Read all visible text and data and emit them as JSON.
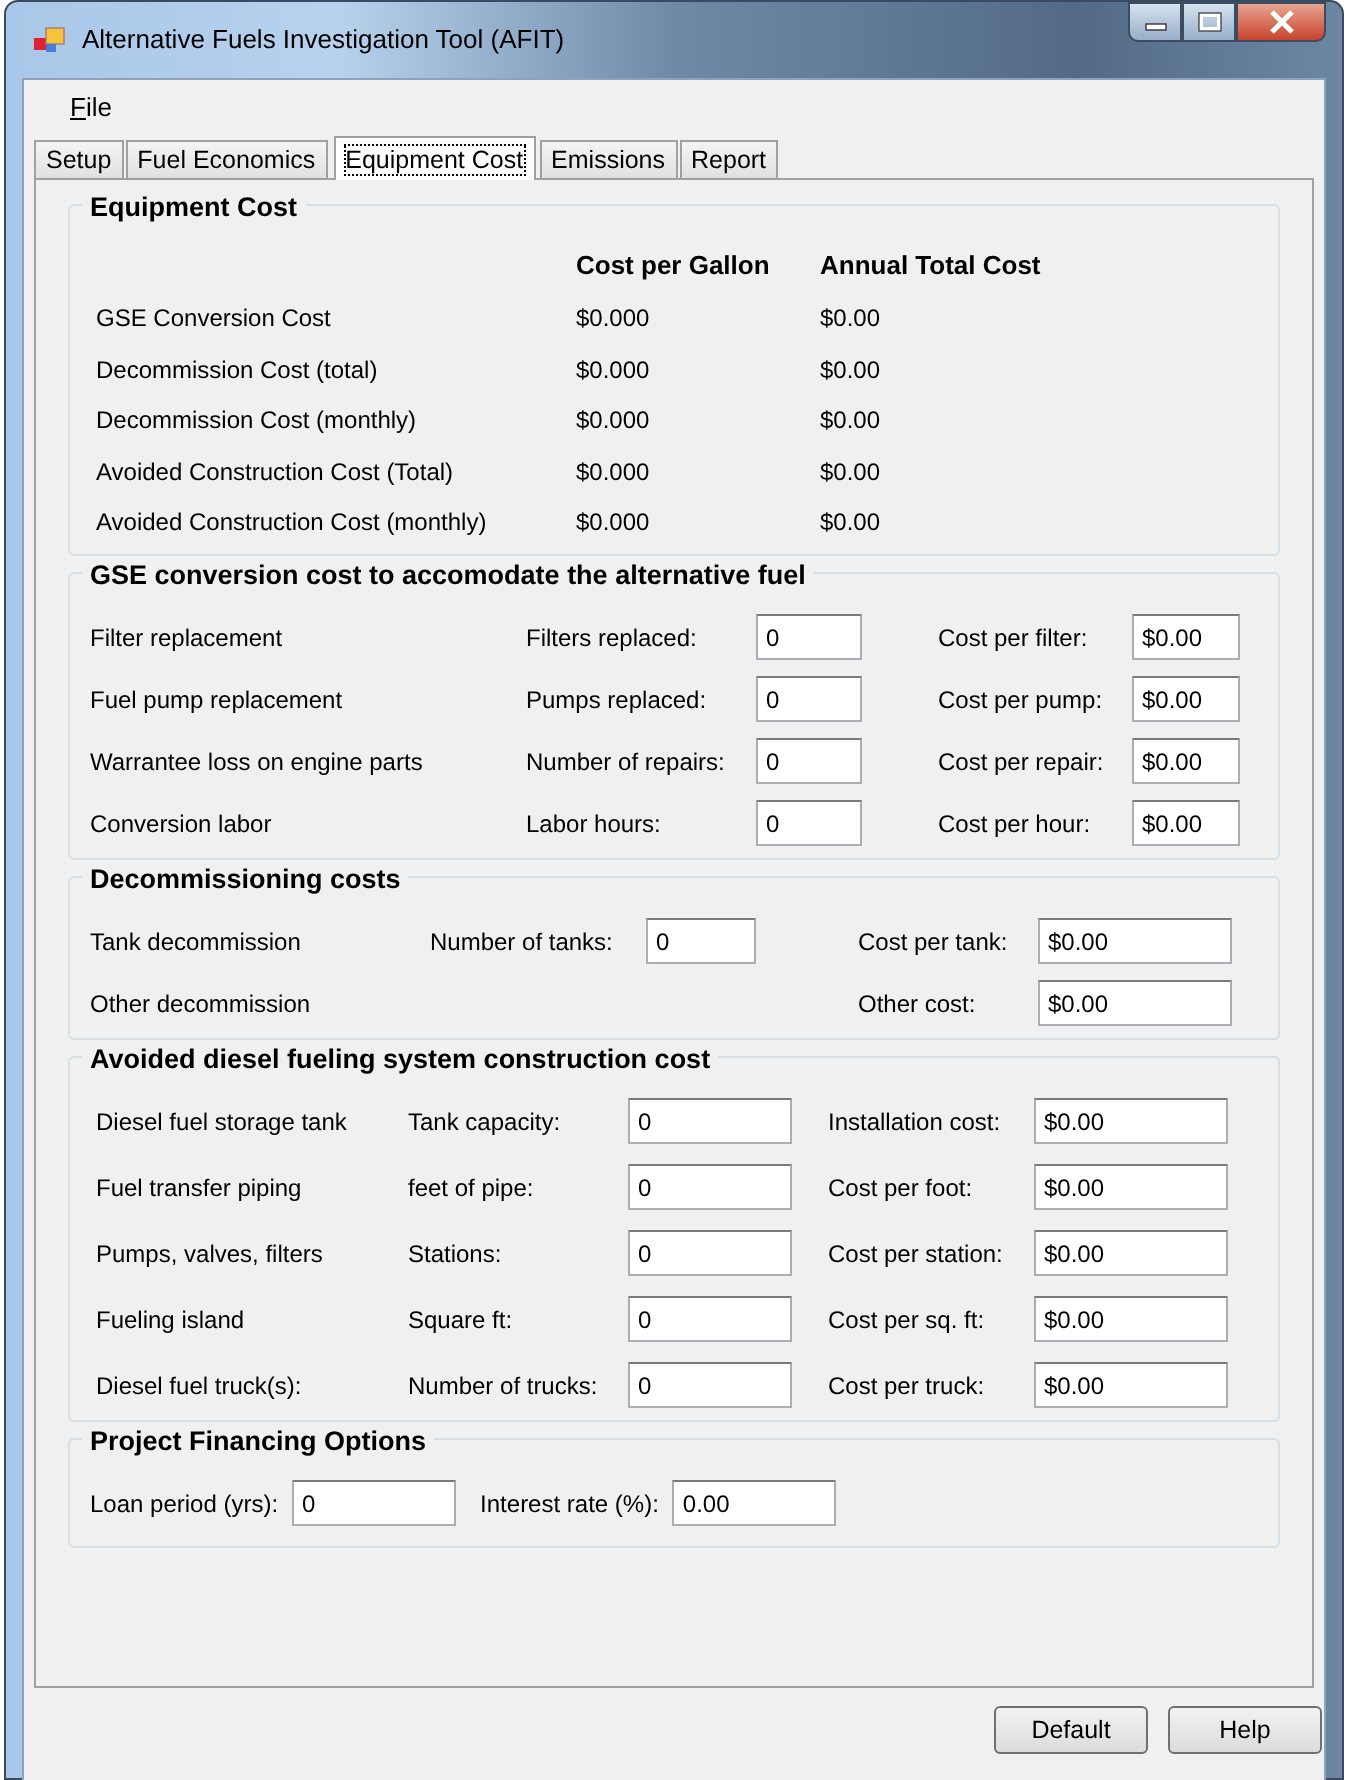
{
  "window": {
    "title": "Alternative Fuels Investigation Tool (AFIT)"
  },
  "menu": [
    {
      "label": "File",
      "accelerator_underlined": true
    }
  ],
  "tabs": [
    {
      "label": "Setup",
      "selected": false
    },
    {
      "label": "Fuel Economics",
      "selected": false
    },
    {
      "label": "Equipment Cost",
      "selected": true
    },
    {
      "label": "Emissions",
      "selected": false
    },
    {
      "label": "Report",
      "selected": false
    }
  ],
  "equipment_cost": {
    "title": "Equipment Cost",
    "columns": [
      "Cost per Gallon",
      "Annual Total Cost"
    ],
    "rows": [
      {
        "label": "GSE Conversion Cost",
        "cost_per_gallon": "$0.000",
        "annual_total": "$0.00"
      },
      {
        "label": "Decommission Cost (total)",
        "cost_per_gallon": "$0.000",
        "annual_total": "$0.00"
      },
      {
        "label": "Decommission Cost (monthly)",
        "cost_per_gallon": "$0.000",
        "annual_total": "$0.00"
      },
      {
        "label": "Avoided Construction Cost (Total)",
        "cost_per_gallon": "$0.000",
        "annual_total": "$0.00"
      },
      {
        "label": "Avoided Construction Cost (monthly)",
        "cost_per_gallon": "$0.000",
        "annual_total": "$0.00"
      }
    ]
  },
  "gse_conversion": {
    "title": "GSE conversion cost to accomodate the alternative fuel",
    "rows": [
      {
        "label": "Filter replacement",
        "qty_label": "Filters replaced:",
        "qty_value": "0",
        "cost_label": "Cost per filter:",
        "cost_value": "$0.00"
      },
      {
        "label": "Fuel pump replacement",
        "qty_label": "Pumps replaced:",
        "qty_value": "0",
        "cost_label": "Cost per pump:",
        "cost_value": "$0.00"
      },
      {
        "label": "Warrantee loss on engine parts",
        "qty_label": "Number of repairs:",
        "qty_value": "0",
        "cost_label": "Cost per repair:",
        "cost_value": "$0.00"
      },
      {
        "label": "Conversion labor",
        "qty_label": "Labor hours:",
        "qty_value": "0",
        "cost_label": "Cost per hour:",
        "cost_value": "$0.00"
      }
    ]
  },
  "decommissioning": {
    "title": "Decommissioning costs",
    "rows": [
      {
        "label": "Tank decommission",
        "qty_label": "Number of tanks:",
        "qty_value": "0",
        "cost_label": "Cost per tank:",
        "cost_value": "$0.00"
      },
      {
        "label": "Other decommission",
        "cost_label": "Other cost:",
        "cost_value": "$0.00"
      }
    ]
  },
  "avoided_construction": {
    "title": "Avoided diesel fueling system construction cost",
    "rows": [
      {
        "label": "Diesel fuel storage tank",
        "qty_label": "Tank capacity:",
        "qty_value": "0",
        "cost_label": "Installation cost:",
        "cost_value": "$0.00"
      },
      {
        "label": "Fuel transfer piping",
        "qty_label": "feet of pipe:",
        "qty_value": "0",
        "cost_label": "Cost per foot:",
        "cost_value": "$0.00"
      },
      {
        "label": "Pumps, valves, filters",
        "qty_label": "Stations:",
        "qty_value": "0",
        "cost_label": "Cost per station:",
        "cost_value": "$0.00"
      },
      {
        "label": "Fueling island",
        "qty_label": "Square ft:",
        "qty_value": "0",
        "cost_label": "Cost per sq. ft:",
        "cost_value": "$0.00"
      },
      {
        "label": "Diesel fuel truck(s):",
        "qty_label": "Number of trucks:",
        "qty_value": "0",
        "cost_label": "Cost per truck:",
        "cost_value": "$0.00"
      }
    ]
  },
  "financing": {
    "title": "Project Financing Options",
    "fields": [
      {
        "label": "Loan period (yrs):",
        "value": "0"
      },
      {
        "label": "Interest rate (%):",
        "value": "0.00"
      }
    ]
  },
  "buttons": [
    "Default",
    "Help"
  ]
}
